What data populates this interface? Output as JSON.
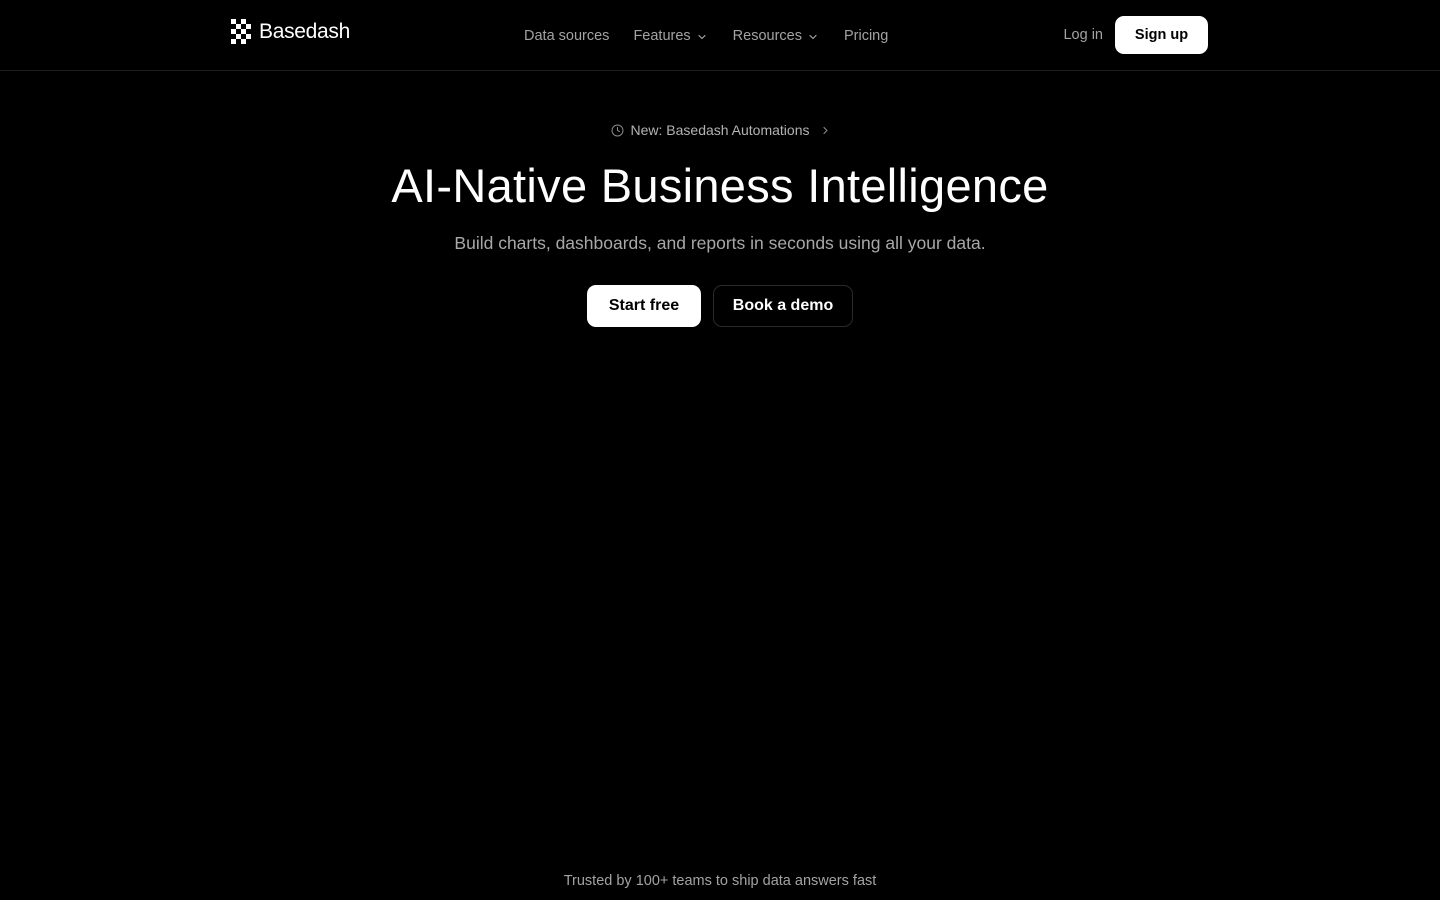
{
  "nav": {
    "brand": "Basedash",
    "links": {
      "data_sources": "Data sources",
      "features": "Features",
      "resources": "Resources",
      "pricing": "Pricing"
    },
    "login": "Log in",
    "signup": "Sign up"
  },
  "hero": {
    "announcement": "New: Basedash Automations",
    "title": "AI-Native Business Intelligence",
    "subtitle": "Build charts, dashboards, and reports in seconds using all your data.",
    "primary_cta": "Start free",
    "secondary_cta": "Book a demo"
  },
  "trusted": "Trusted by 100+ teams to ship data answers fast",
  "colors": {
    "background": "#000000",
    "text": "#ffffff",
    "muted": "#a3a3a3",
    "border": "#1f1f1f"
  },
  "icons": {
    "logo": "checker-logo-icon",
    "dropdown": "chevron-down-icon",
    "announcement": "clock-icon",
    "announcement_arrow": "chevron-right-icon"
  }
}
